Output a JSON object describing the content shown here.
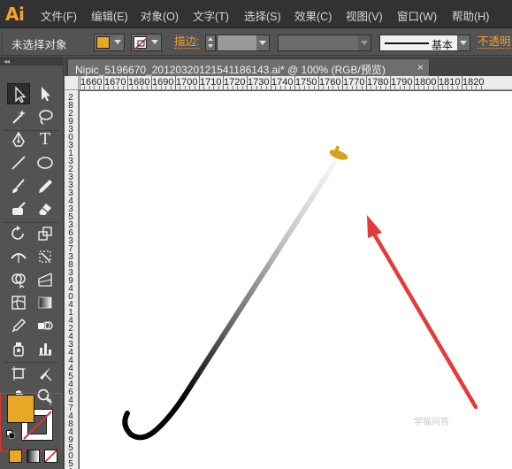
{
  "app": {
    "logo": "Ai"
  },
  "menu": {
    "items": [
      "文件(F)",
      "编辑(E)",
      "对象(O)",
      "文字(T)",
      "选择(S)",
      "效果(C)",
      "视图(V)",
      "窗口(W)",
      "帮助(H)"
    ]
  },
  "control_bar": {
    "selection_status": "未选择对象",
    "fill_color": "#e8a823",
    "stroke_label": "描边:",
    "stroke_weight": "",
    "brush_label": "基本",
    "opacity_label": "不透明"
  },
  "document": {
    "tab_label": "Nipic_5196670_20120320121541186143.ai* @ 100% (RGB/预览)",
    "close_glyph": "×"
  },
  "ruler": {
    "h_labels": [
      "1660",
      "1670",
      "1680",
      "1690",
      "1700",
      "1710",
      "1720",
      "1730",
      "1740",
      "1750",
      "1760",
      "1770",
      "1780",
      "1790",
      "1800",
      "1810",
      "1820"
    ],
    "v_labels": [
      "2",
      "8",
      "2",
      "9",
      "3",
      "0",
      "3",
      "1",
      "3",
      "2",
      "3",
      "3",
      "3",
      "4",
      "3",
      "5",
      "3",
      "6",
      "3",
      "7",
      "3",
      "8",
      "3",
      "9",
      "4",
      "0",
      "4",
      "1",
      "4",
      "2",
      "4",
      "3",
      "4",
      "4",
      "4",
      "5",
      "4",
      "6",
      "4",
      "7",
      "4",
      "8",
      "4",
      "9",
      "5",
      "0",
      "5",
      "1",
      "5",
      "2"
    ]
  },
  "artwork": {
    "cane_tip_color": "#d4a21c",
    "arrow_color": "#e8393a"
  },
  "tools": {
    "text_tool_glyph": "T",
    "fill_color": "#e8a823",
    "swap_glyph": "↰"
  },
  "watermark": "学猫问答"
}
